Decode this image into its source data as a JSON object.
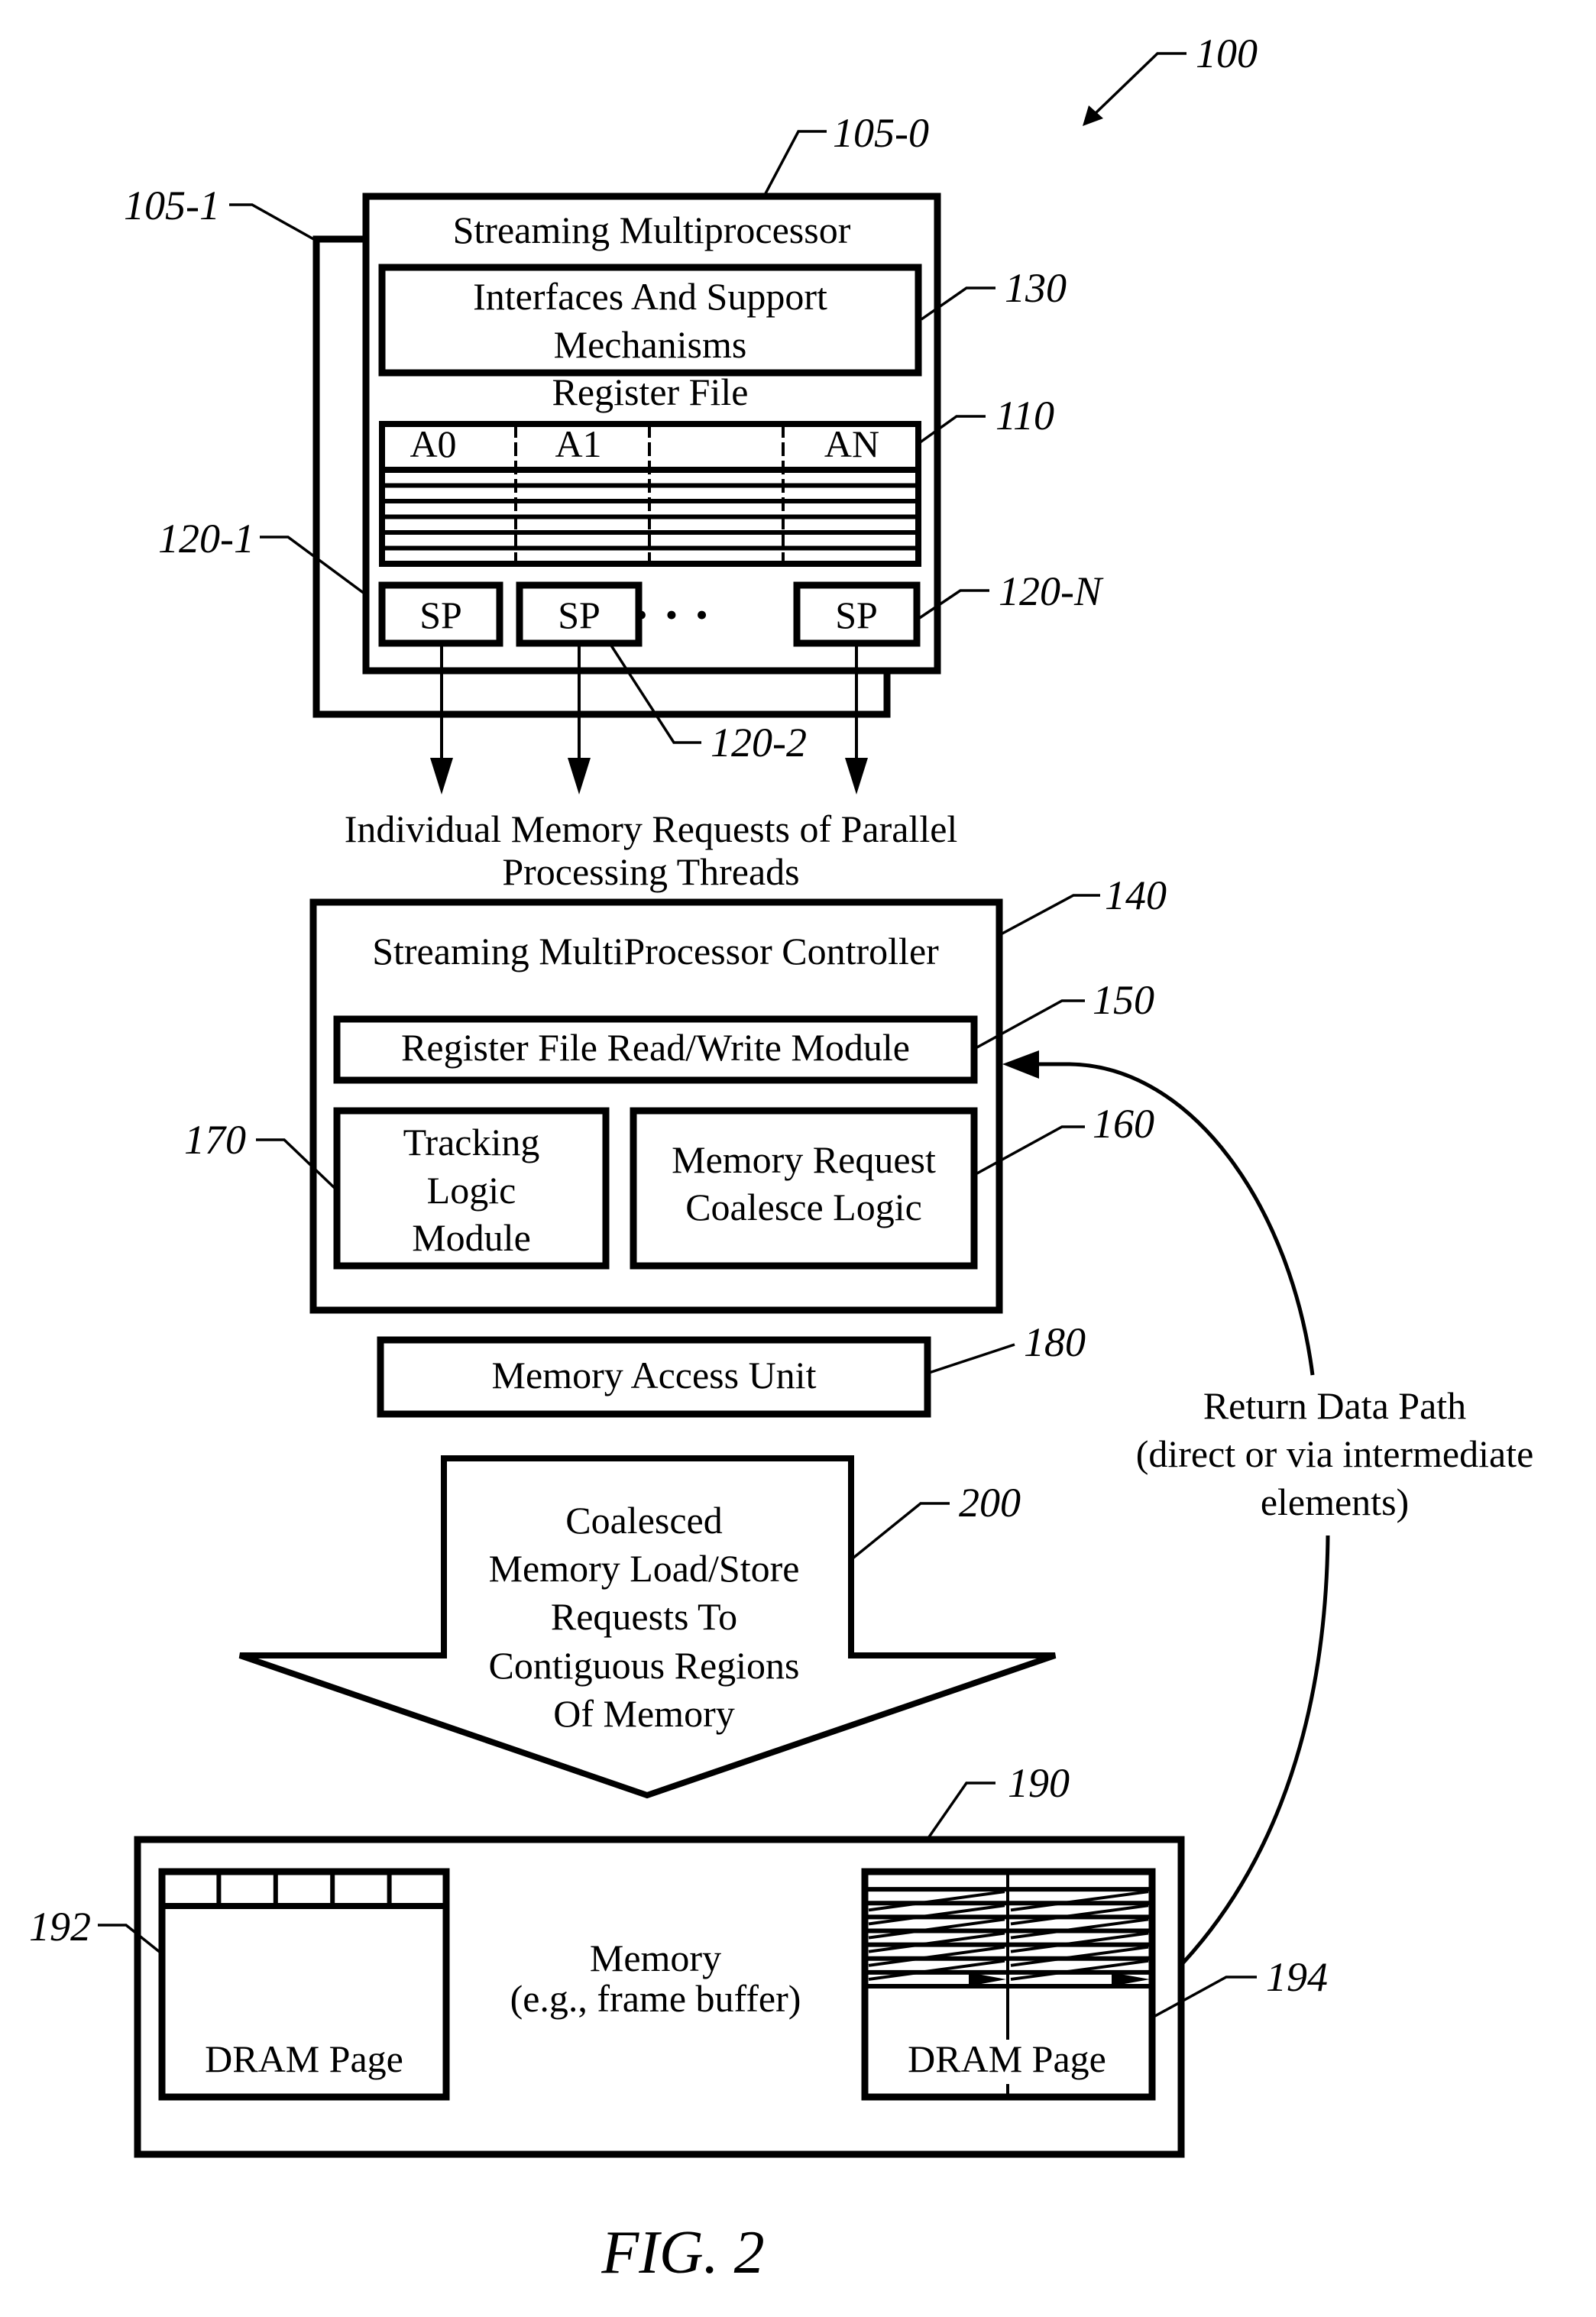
{
  "figure": {
    "caption": "FIG. 2",
    "system_ref": "100"
  },
  "sm": {
    "ref_front": "105-0",
    "ref_back": "105-1",
    "title": "Streaming Multiprocessor",
    "interfaces": {
      "ref": "130",
      "lines": [
        "Interfaces And Support",
        "Mechanisms"
      ]
    },
    "register_file": {
      "ref": "110",
      "title": "Register File",
      "columns": [
        "A0",
        "A1",
        "",
        "AN"
      ],
      "row_count": 6
    },
    "processors": {
      "label": "SP",
      "ellipsis": "• • •",
      "refs": [
        "120-1",
        "120-2",
        "120-N"
      ]
    }
  },
  "requests_caption": [
    "Individual Memory Requests of Parallel",
    "Processing Threads"
  ],
  "controller": {
    "ref": "140",
    "title": "Streaming MultiProcessor Controller",
    "rw_module": {
      "ref": "150",
      "label": "Register File Read/Write Module"
    },
    "tracking": {
      "ref": "170",
      "lines": [
        "Tracking",
        "Logic",
        "Module"
      ]
    },
    "coalesce": {
      "ref": "160",
      "lines": [
        "Memory Request",
        "Coalesce Logic"
      ]
    }
  },
  "memory_access_unit": {
    "ref": "180",
    "label": "Memory Access Unit"
  },
  "coalesced_arrow": {
    "ref": "200",
    "lines": [
      "Coalesced",
      "Memory Load/Store",
      "Requests To",
      "Contiguous Regions",
      "Of Memory"
    ]
  },
  "return_path": {
    "lines": [
      "Return Data Path",
      "(direct or via intermediate",
      "elements)"
    ]
  },
  "memory": {
    "ref": "190",
    "lines": [
      "Memory",
      "(e.g., frame buffer)"
    ],
    "page_left": {
      "ref": "192",
      "label": "DRAM Page",
      "cells": 5
    },
    "page_right": {
      "ref": "194",
      "label": "DRAM Page",
      "rows": 8
    }
  }
}
